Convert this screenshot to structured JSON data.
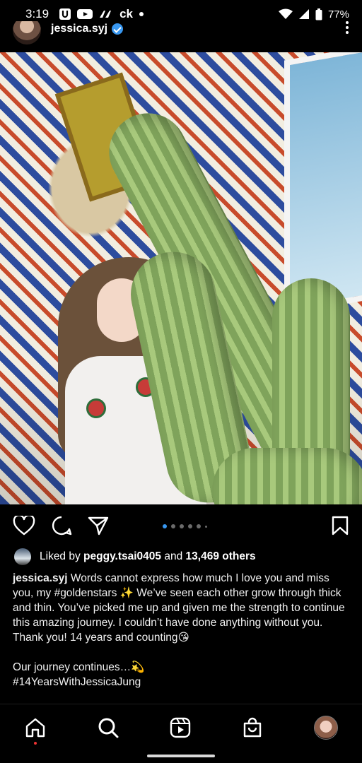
{
  "status_bar": {
    "time": "3:19",
    "app_icons": [
      "u-app-icon",
      "youtube-icon",
      "ai-app-icon",
      "ck-icon",
      "dot-icon"
    ],
    "ck_label": "ck",
    "battery": "77%"
  },
  "post": {
    "username": "jessica.syj",
    "verified": true,
    "carousel": {
      "count": 6,
      "active_index": 0
    },
    "likes": {
      "prefix": "Liked by",
      "liker": "peggy.tsai0405",
      "and": "and",
      "others": "13,469 others"
    },
    "caption": {
      "username": "jessica.syj",
      "text": " Words cannot express how much I love you and miss you, my #goldenstars ✨ We’ve seen each other grow through thick and thin. You’ve picked me up and given me the strength to continue this amazing journey. I couldn’t have done anything without you. Thank you! 14 years and counting😘\n\nOur journey continues…💫\n#14YearsWithJessicaJung"
    }
  },
  "nav": {
    "items": [
      "home-icon",
      "search-icon",
      "reels-icon",
      "shop-icon",
      "profile-avatar"
    ],
    "active": "home-icon"
  },
  "colors": {
    "background": "#000000",
    "accent": "#3897f0",
    "notification": "#e33333"
  }
}
